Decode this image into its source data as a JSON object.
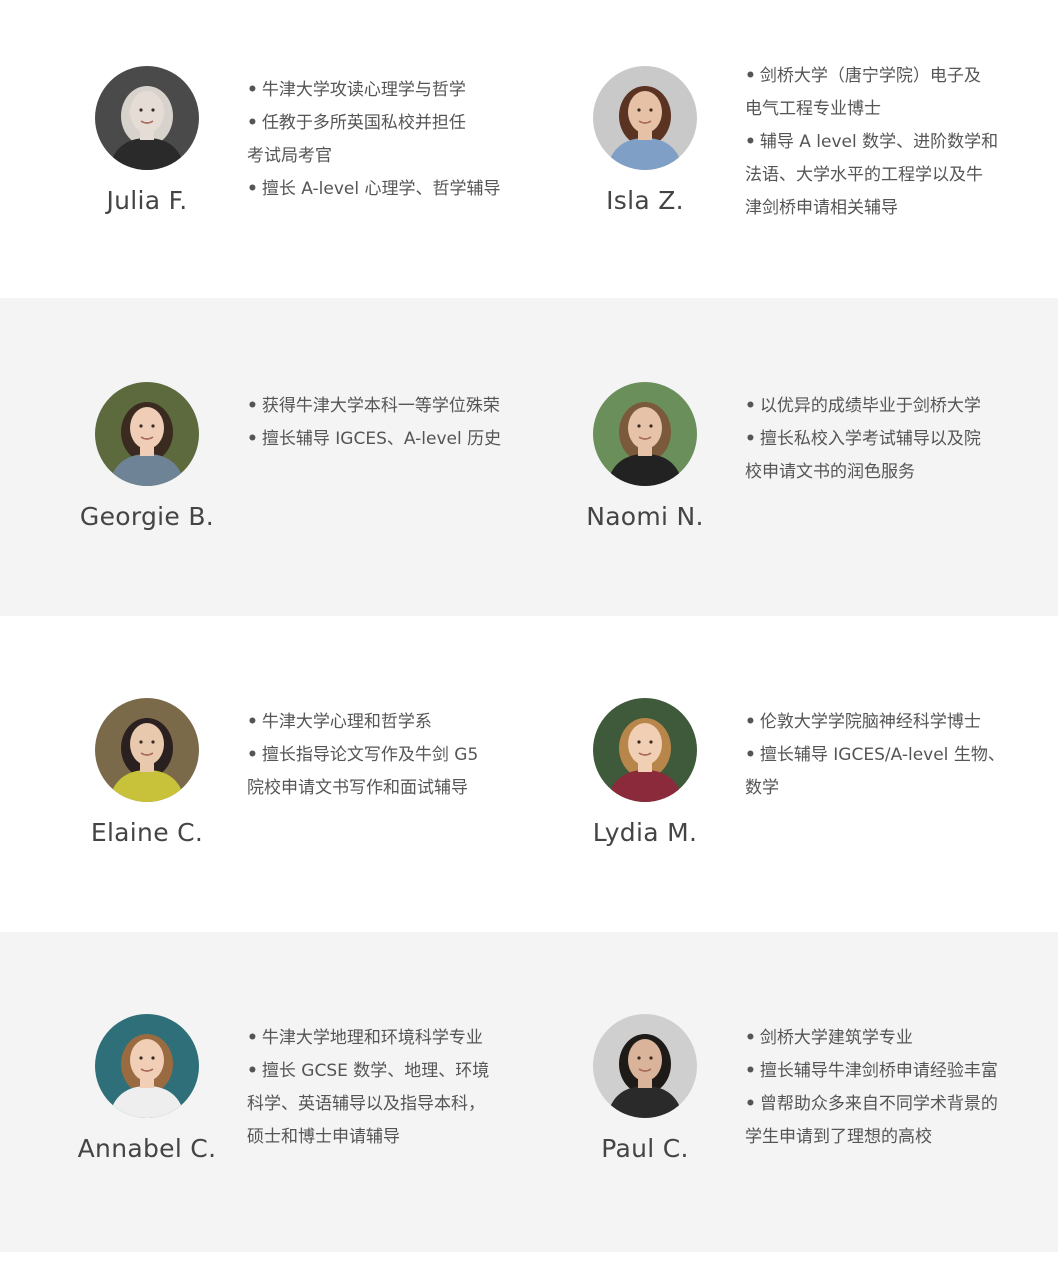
{
  "tutors": [
    {
      "name": "Julia F.",
      "avatar_palette": {
        "bg": "#4a4a4a",
        "skin": "#e6dcd6",
        "hair": "#d8d2cc",
        "cloth": "#2a2a2a"
      },
      "bullets": [
        {
          "lines": [
            "牛津大学攻读心理学与哲学"
          ]
        },
        {
          "lines": [
            "任教于多所英国私校并担任",
            "考试局考官"
          ]
        },
        {
          "lines": [
            "擅长 A-level 心理学、哲学辅导"
          ]
        }
      ]
    },
    {
      "name": "Isla Z.",
      "avatar_palette": {
        "bg": "#c9c9c9",
        "skin": "#e7c1a6",
        "hair": "#5a3322",
        "cloth": "#7f9fc6"
      },
      "bullets": [
        {
          "lines": [
            "剑桥大学（唐宁学院）电子及",
            "电气工程专业博士"
          ]
        },
        {
          "lines": [
            "辅导 A level 数学、进阶数学和",
            "法语、大学水平的工程学以及牛",
            "津剑桥申请相关辅导"
          ]
        }
      ]
    },
    {
      "name": "Georgie B.",
      "avatar_palette": {
        "bg": "#5c6a3d",
        "skin": "#efcdb6",
        "hair": "#3a2a20",
        "cloth": "#6f8396"
      },
      "bullets": [
        {
          "lines": [
            "获得牛津大学本科一等学位殊荣"
          ]
        },
        {
          "lines": [
            "擅长辅导 IGCES、A-level 历史"
          ]
        }
      ]
    },
    {
      "name": "Naomi N.",
      "avatar_palette": {
        "bg": "#6a8f5a",
        "skin": "#e6c2a8",
        "hair": "#7a5a3a",
        "cloth": "#222222"
      },
      "bullets": [
        {
          "lines": [
            "以优异的成绩毕业于剑桥大学"
          ]
        },
        {
          "lines": [
            "擅长私校入学考试辅导以及院",
            "校申请文书的润色服务"
          ]
        }
      ]
    },
    {
      "name": "Elaine C.",
      "avatar_palette": {
        "bg": "#7a6a4a",
        "skin": "#e8c9ad",
        "hair": "#2a2020",
        "cloth": "#c8c23a"
      },
      "bullets": [
        {
          "lines": [
            "牛津大学心理和哲学系"
          ]
        },
        {
          "lines": [
            "擅长指导论文写作及牛剑 G5",
            "院校申请文书写作和面试辅导"
          ]
        }
      ]
    },
    {
      "name": "Lydia M.",
      "avatar_palette": {
        "bg": "#3f5a3a",
        "skin": "#f0cfb5",
        "hair": "#b8864a",
        "cloth": "#8a2a3a"
      },
      "bullets": [
        {
          "lines": [
            "伦敦大学学院脑神经科学博士"
          ]
        },
        {
          "lines": [
            "擅长辅导 IGCES/A-level 生物、",
            "数学"
          ]
        }
      ]
    },
    {
      "name": "Annabel C.",
      "avatar_palette": {
        "bg": "#2f6f7a",
        "skin": "#f0cfb6",
        "hair": "#9a6a40",
        "cloth": "#eeeeee"
      },
      "bullets": [
        {
          "lines": [
            "牛津大学地理和环境科学专业"
          ]
        },
        {
          "lines": [
            "擅长 GCSE 数学、地理、环境",
            "科学、英语辅导以及指导本科，",
            "硕士和博士申请辅导"
          ]
        }
      ]
    },
    {
      "name": "Paul C.",
      "avatar_palette": {
        "bg": "#cfcfcf",
        "skin": "#d9b39a",
        "hair": "#1e1a18",
        "cloth": "#2a2a2a"
      },
      "bullets": [
        {
          "lines": [
            "剑桥大学建筑学专业"
          ]
        },
        {
          "lines": [
            "擅长辅导牛津剑桥申请经验丰富"
          ]
        },
        {
          "lines": [
            "曾帮助众多来自不同学术背景的",
            "学生申请到了理想的高校"
          ]
        }
      ]
    }
  ],
  "bullet_symbol": "•",
  "colors": {
    "row_grey": "#f4f4f4",
    "row_white": "#ffffff",
    "name_text": "#444444",
    "bio_text": "#555555"
  }
}
